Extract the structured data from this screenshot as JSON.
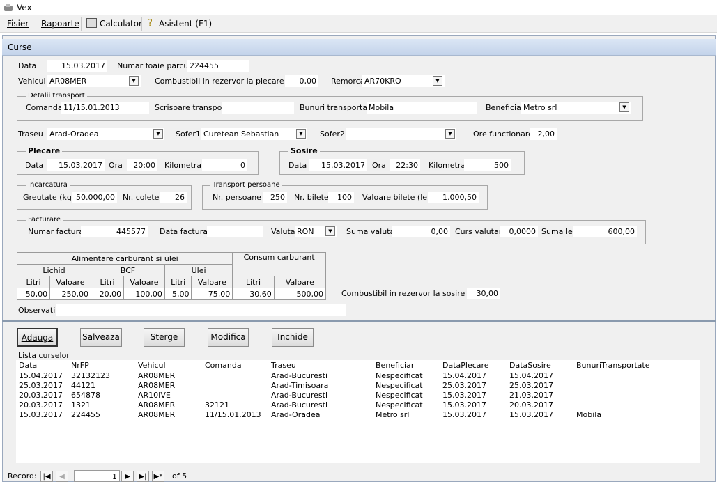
{
  "window": {
    "title": "Vex"
  },
  "menu": {
    "fisier": "Fisier",
    "rapoarte": "Rapoarte",
    "calculator": "Calculator",
    "asistent": "Asistent (F1)"
  },
  "form": {
    "title": "Curse",
    "data_label": "Data",
    "data_value": "15.03.2017",
    "foaie_label": "Numar foaie parcurs",
    "foaie_value": "224455",
    "vehicul_label": "Vehicul",
    "vehicul_value": "AR08MER",
    "comb_plecare_label": "Combustibil in rezervor la plecare (litri)",
    "comb_plecare_value": "0,00",
    "remorca_label": "Remorca",
    "remorca_value": "AR70KRO",
    "transport": {
      "group_label": "Detalii transport",
      "comanda_label": "Comanda",
      "comanda_value": "11/15.01.2013",
      "scrisoare_label": "Scrisoare transport",
      "scrisoare_value": "",
      "bunuri_label": "Bunuri transportate",
      "bunuri_value": "Mobila",
      "beneficiar_label": "Beneficiar",
      "beneficiar_value": "Metro srl"
    },
    "traseu_label": "Traseu",
    "traseu_value": "Arad-Oradea",
    "sofer1_label": "Sofer1",
    "sofer1_value": "Curetean Sebastian",
    "sofer2_label": "Sofer2",
    "sofer2_value": "",
    "ore_label": "Ore functionare",
    "ore_value": "2,00",
    "plecare": {
      "group_label": "Plecare",
      "data_label": "Data",
      "data_value": "15.03.2017",
      "ora_label": "Ora",
      "ora_value": "20:00",
      "km_label": "Kilometraj",
      "km_value": "0"
    },
    "sosire": {
      "group_label": "Sosire",
      "data_label": "Data",
      "data_value": "15.03.2017",
      "ora_label": "Ora",
      "ora_value": "22:30",
      "km_label": "Kilometraj",
      "km_value": "500"
    },
    "incarcatura": {
      "group_label": "Incarcatura",
      "greutate_label": "Greutate (kg)",
      "greutate_value": "50.000,00",
      "colete_label": "Nr. colete",
      "colete_value": "26"
    },
    "persoane": {
      "group_label": "Transport persoane",
      "nr_label": "Nr. persoane",
      "nr_value": "250",
      "bilete_label": "Nr. bilete",
      "bilete_value": "100",
      "valoare_label": "Valoare bilete (lei)",
      "valoare_value": "1.000,50"
    },
    "facturare": {
      "group_label": "Facturare",
      "numar_label": "Numar factura",
      "numar_value": "445577",
      "data_label": "Data factura",
      "data_value": "",
      "valuta_label": "Valuta",
      "valuta_value": "RON",
      "suma_valuta_label": "Suma valuta",
      "suma_valuta_value": "0,00",
      "curs_label": "Curs valutar",
      "curs_value": "0,0000",
      "suma_lei_label": "Suma lei",
      "suma_lei_value": "600,00"
    },
    "carburant": {
      "alimentare_header": "Alimentare carburant si ulei",
      "consum_header": "Consum carburant",
      "lichid": "Lichid",
      "bcf": "BCF",
      "ulei": "Ulei",
      "litri": "Litri",
      "valoare": "Valoare",
      "values": [
        "50,00",
        "250,00",
        "20,00",
        "100,00",
        "5,00",
        "75,00",
        "30,60",
        "500,00"
      ]
    },
    "comb_sosire_label": "Combustibil in rezervor la sosire (litri)",
    "comb_sosire_value": "30,00",
    "observatii_label": "Observatii",
    "observatii_value": ""
  },
  "buttons": {
    "adauga": "Adauga",
    "salveaza": "Salveaza",
    "sterge": "Sterge",
    "modifica": "Modifica",
    "inchide": "Inchide"
  },
  "list": {
    "title": "Lista curselor",
    "columns": [
      "Data",
      "NrFP",
      "Vehicul",
      "Comanda",
      "Traseu",
      "Beneficiar",
      "DataPlecare",
      "DataSosire",
      "BunuriTransportate"
    ],
    "rows": [
      [
        "15.04.2017",
        "32132123",
        "AR08MER",
        "",
        "Arad-Bucuresti",
        "Nespecificat",
        "15.04.2017",
        "15.04.2017",
        ""
      ],
      [
        "25.03.2017",
        "44121",
        "AR08MER",
        "",
        "Arad-Timisoara",
        "Nespecificat",
        "25.03.2017",
        "25.03.2017",
        ""
      ],
      [
        "20.03.2017",
        "654878",
        "AR10IVE",
        "",
        "Arad-Bucuresti",
        "Nespecificat",
        "15.03.2017",
        "21.03.2017",
        ""
      ],
      [
        "20.03.2017",
        "1321",
        "AR08MER",
        "32121",
        "Arad-Bucuresti",
        "Nespecificat",
        "15.03.2017",
        "20.03.2017",
        ""
      ],
      [
        "15.03.2017",
        "224455",
        "AR08MER",
        "11/15.01.2013",
        "Arad-Oradea",
        "Metro srl",
        "15.03.2017",
        "15.03.2017",
        "Mobila"
      ]
    ]
  },
  "record": {
    "label": "Record:",
    "current": "1",
    "of_label": "of 5"
  }
}
